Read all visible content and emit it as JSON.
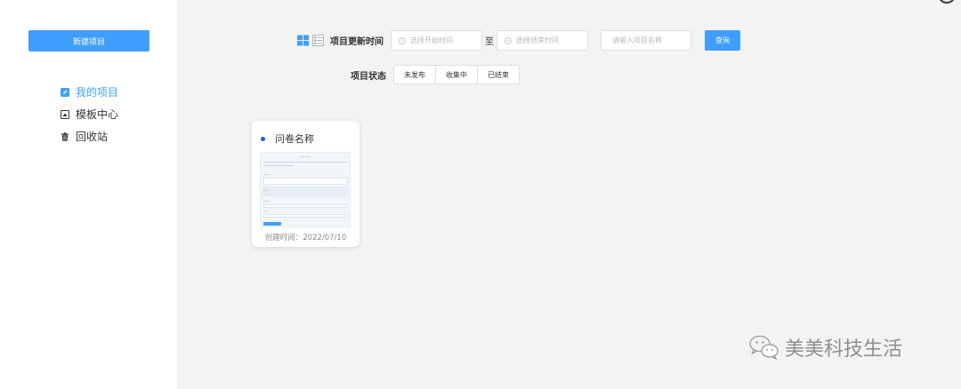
{
  "sidebar": {
    "new_button": "新建项目",
    "items": [
      {
        "label": "我的项目",
        "icon": "edit-icon",
        "active": true
      },
      {
        "label": "模板中心",
        "icon": "template-icon",
        "active": false
      },
      {
        "label": "回收站",
        "icon": "trash-icon",
        "active": false
      }
    ]
  },
  "filters": {
    "update_time_label": "项目更新时间",
    "start_placeholder": "选择开始时间",
    "to_text": "至",
    "end_placeholder": "选择结束时间",
    "name_placeholder": "请输入项目名称",
    "query_button": "查询",
    "status_label": "项目状态",
    "status_options": [
      "未发布",
      "收集中",
      "已结束"
    ]
  },
  "projects": [
    {
      "title": "问卷名称",
      "created": "创建时间：2022/07/10"
    }
  ],
  "watermark": {
    "text": "美美科技生活",
    "icon": "wechat-icon"
  },
  "colors": {
    "primary": "#409eff",
    "dot": "#1a5fd8",
    "background": "#f3f3f3"
  }
}
